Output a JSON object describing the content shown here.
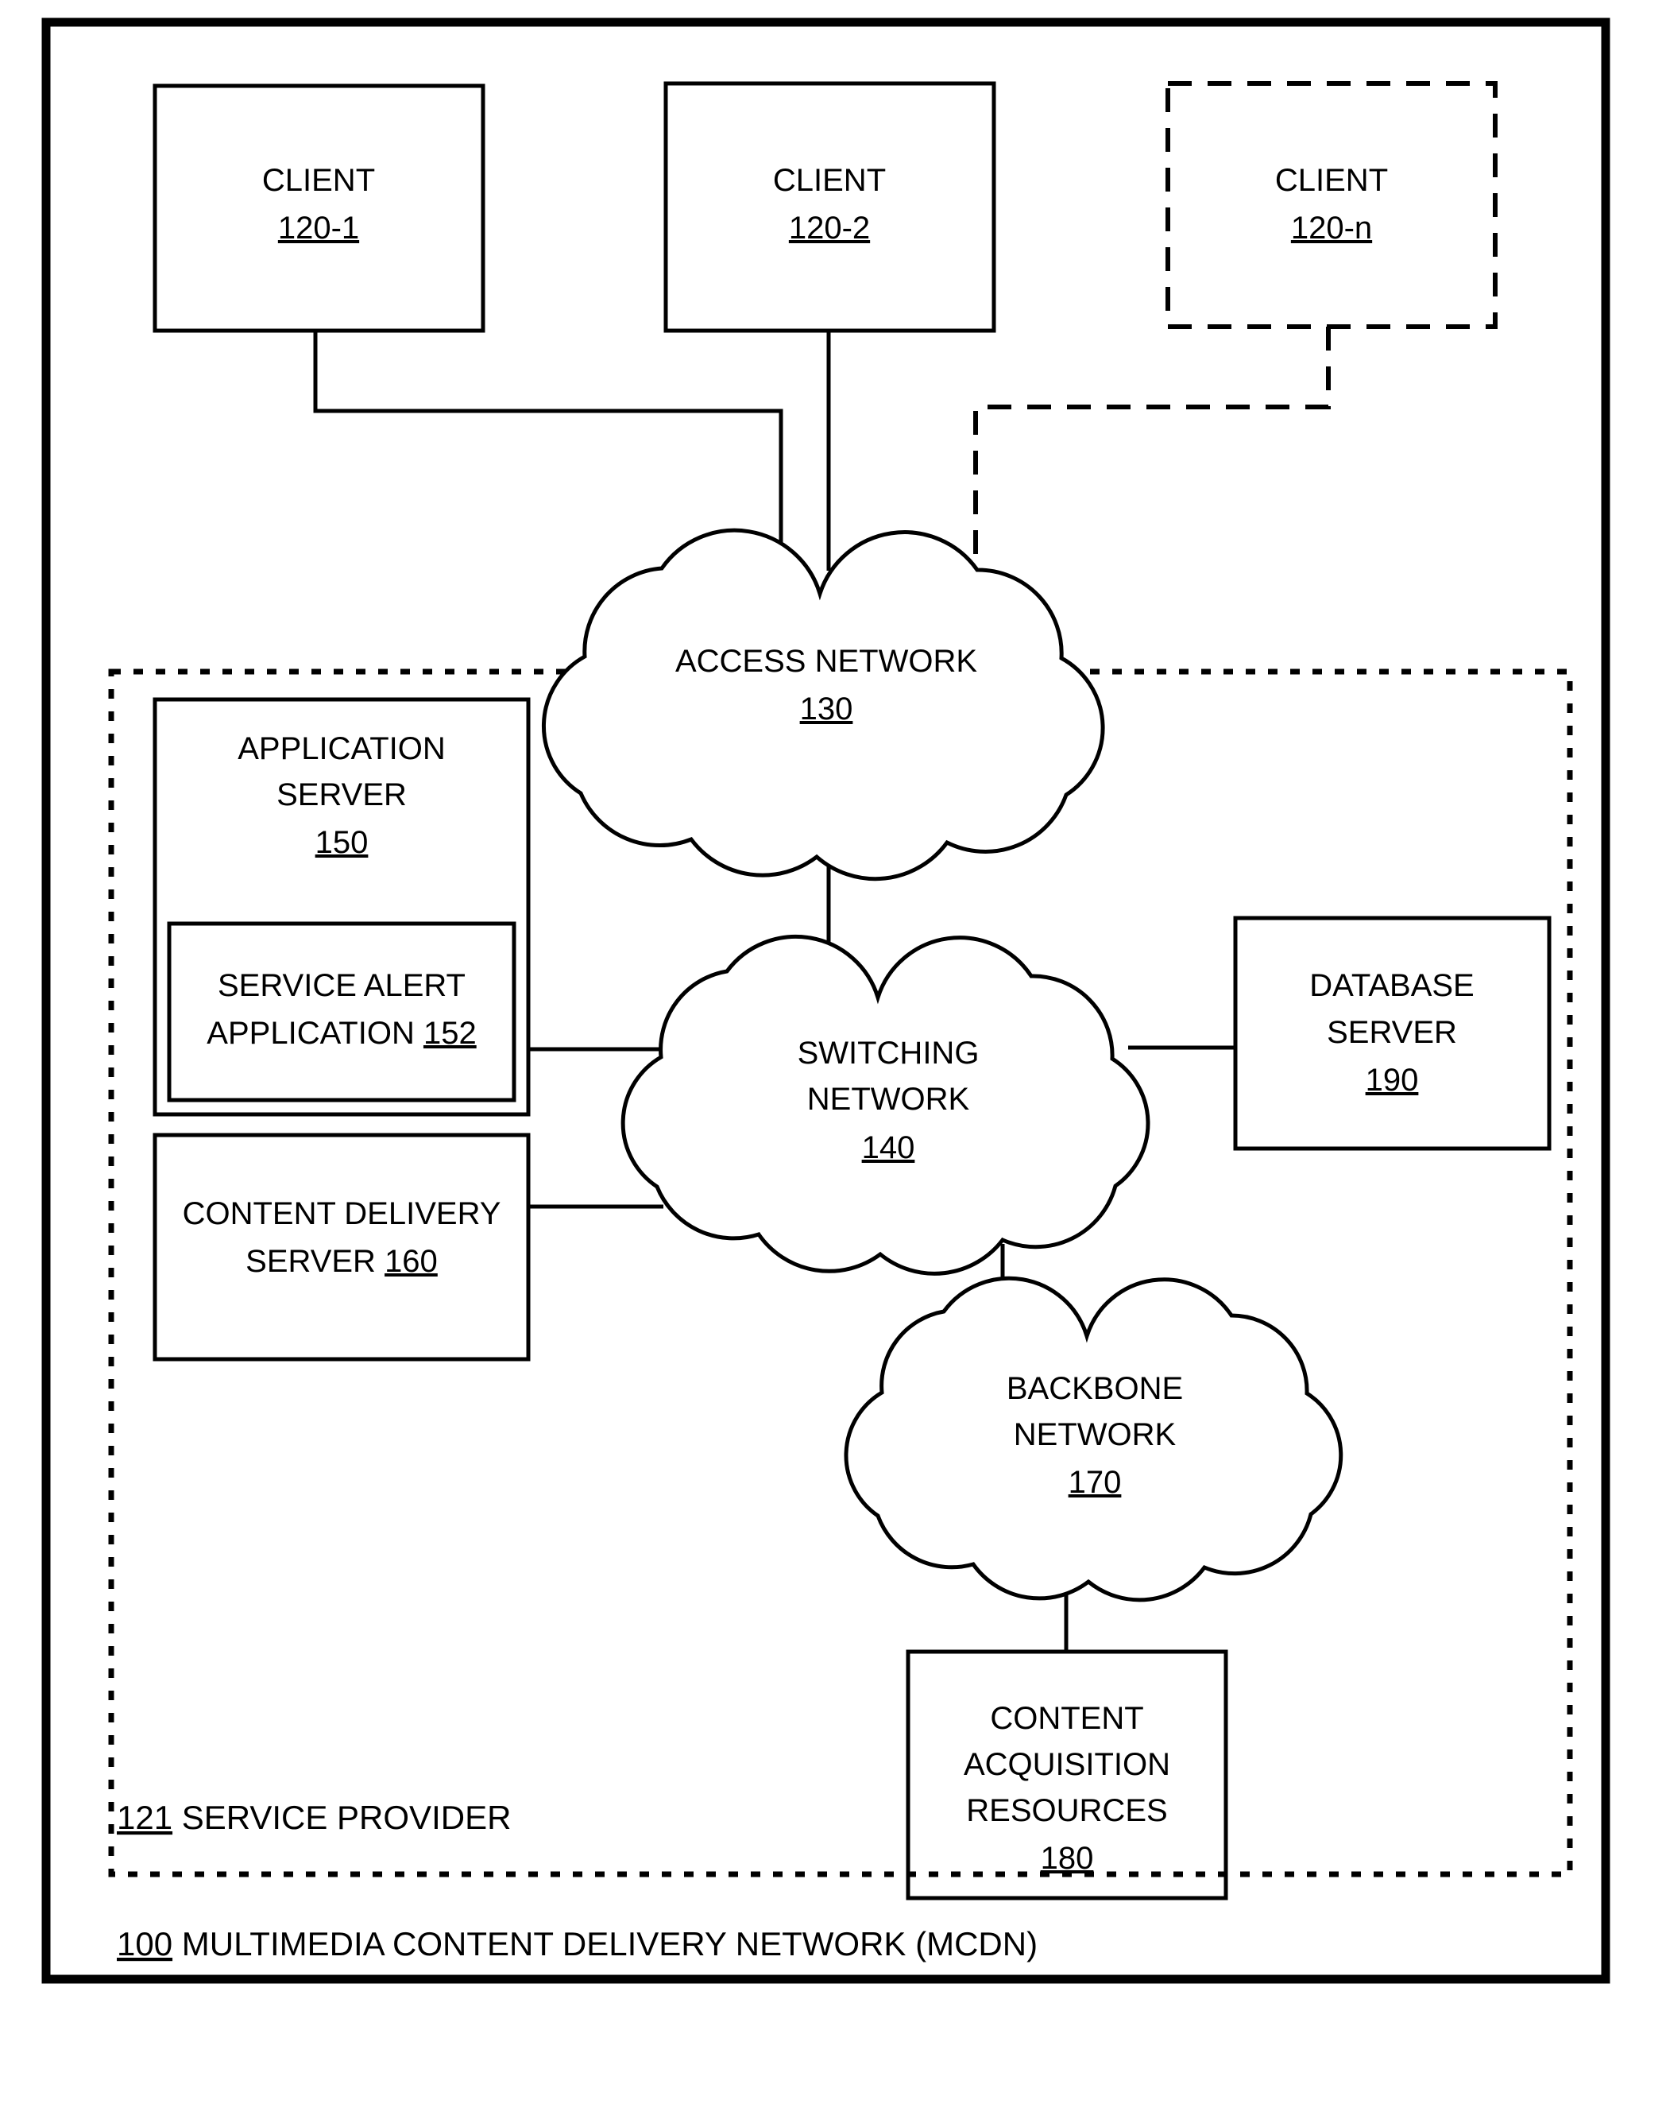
{
  "figure": {
    "caption": {
      "ref": "100",
      "text": " MULTIMEDIA CONTENT DELIVERY NETWORK (MCDN)"
    },
    "service_provider": {
      "ref": "121",
      "text": " SERVICE PROVIDER"
    }
  },
  "nodes": {
    "client_1": {
      "title": "CLIENT",
      "ref": "120-1",
      "shape": "rectangle",
      "border": "solid"
    },
    "client_2": {
      "title": "CLIENT",
      "ref": "120-2",
      "shape": "rectangle",
      "border": "solid"
    },
    "client_n": {
      "title": "CLIENT",
      "ref": "120-n",
      "shape": "rectangle",
      "border": "dashed"
    },
    "access_network": {
      "title": "ACCESS NETWORK",
      "ref": "130",
      "shape": "cloud"
    },
    "application_server": {
      "title_line1": "APPLICATION",
      "title_line2": "SERVER",
      "ref": "150",
      "shape": "rectangle",
      "border": "solid"
    },
    "service_alert_application": {
      "title_line1": "SERVICE ALERT",
      "title_line2": "APPLICATION ",
      "ref": "152",
      "shape": "rectangle",
      "border": "solid"
    },
    "content_delivery_server": {
      "title_line1": "CONTENT DELIVERY",
      "title_line2": "SERVER ",
      "ref": "160",
      "shape": "rectangle",
      "border": "solid"
    },
    "switching_network": {
      "title_line1": "SWITCHING",
      "title_line2": "NETWORK",
      "ref": "140",
      "shape": "cloud"
    },
    "database_server": {
      "title_line1": "DATABASE",
      "title_line2": "SERVER",
      "ref": "190",
      "shape": "rectangle",
      "border": "solid"
    },
    "backbone_network": {
      "title_line1": "BACKBONE",
      "title_line2": "NETWORK",
      "ref": "170",
      "shape": "cloud"
    },
    "content_acquisition_resources": {
      "title_line1": "CONTENT",
      "title_line2": "ACQUISITION",
      "title_line3": "RESOURCES",
      "ref": "180",
      "shape": "rectangle",
      "border": "solid"
    }
  },
  "connections": [
    {
      "from": "client_1",
      "to": "access_network",
      "style": "solid"
    },
    {
      "from": "client_2",
      "to": "access_network",
      "style": "solid"
    },
    {
      "from": "client_n",
      "to": "access_network",
      "style": "dashed"
    },
    {
      "from": "access_network",
      "to": "switching_network",
      "style": "solid"
    },
    {
      "from": "application_server",
      "to": "switching_network",
      "style": "solid"
    },
    {
      "from": "content_delivery_server",
      "to": "switching_network",
      "style": "solid"
    },
    {
      "from": "switching_network",
      "to": "database_server",
      "style": "solid"
    },
    {
      "from": "switching_network",
      "to": "backbone_network",
      "style": "solid"
    },
    {
      "from": "backbone_network",
      "to": "content_acquisition_resources",
      "style": "solid"
    }
  ],
  "colors": {
    "stroke": "#000000",
    "background": "#ffffff"
  }
}
